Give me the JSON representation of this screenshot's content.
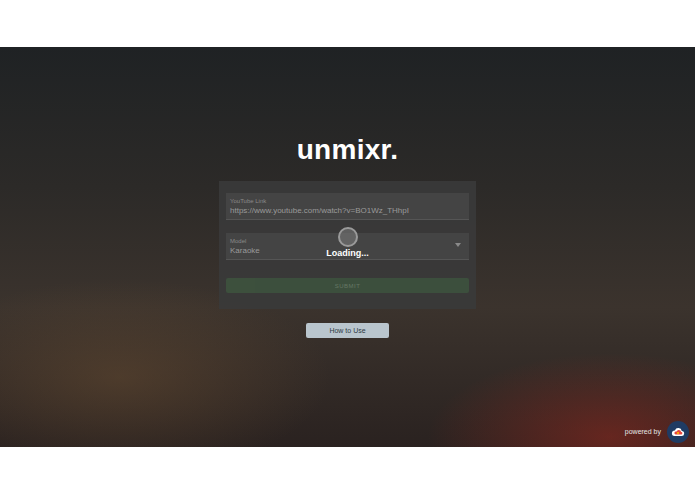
{
  "app": {
    "title": "unmixr."
  },
  "form": {
    "fields": [
      {
        "label": "YouTube Link",
        "value": "https://www.youtube.com/watch?v=BO1Wz_THhpI",
        "kind": "text"
      },
      {
        "label": "Model",
        "value": "Karaoke",
        "kind": "select"
      }
    ],
    "submit": {
      "label": "SUBMIT",
      "disabled": true
    }
  },
  "loading": {
    "label": "Loading..."
  },
  "help_button": {
    "label": "How to Use"
  },
  "footer": {
    "powered_by": "powered by"
  }
}
